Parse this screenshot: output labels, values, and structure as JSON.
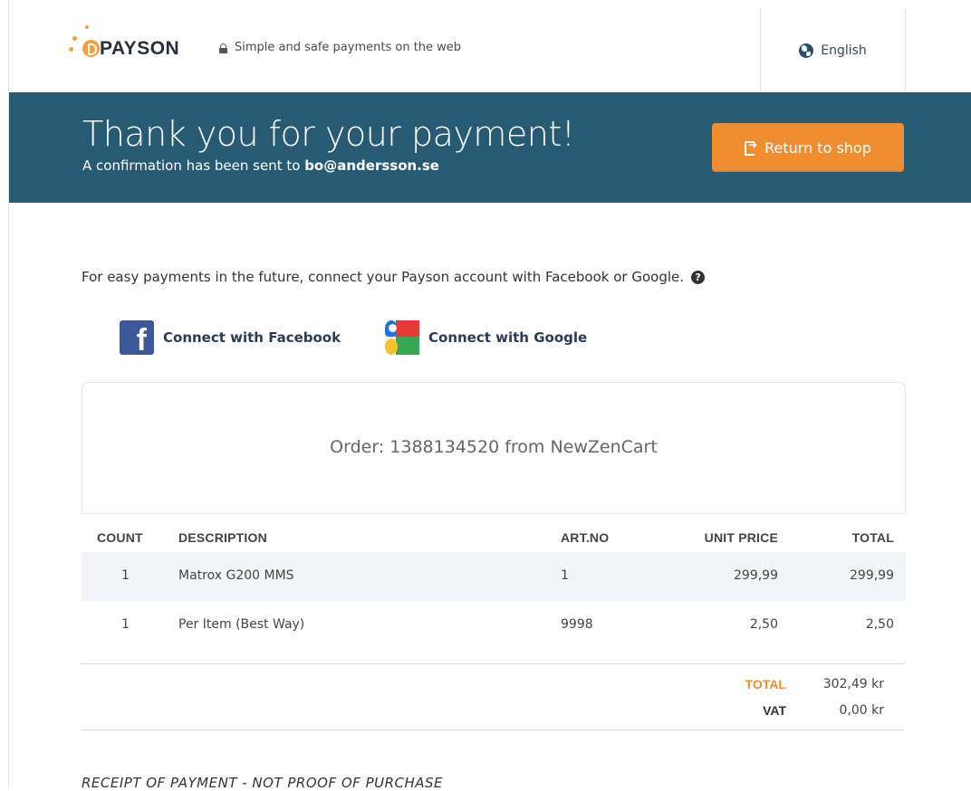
{
  "header": {
    "logo_text": "PAYSON",
    "tagline": "Simple and safe payments on the web",
    "language": "English"
  },
  "banner": {
    "title": "Thank you for your payment!",
    "subtitle_prefix": "A confirmation has been sent to ",
    "email": "bo@andersson.se",
    "return_button": "Return to shop"
  },
  "connect": {
    "text": "For easy payments in the future, connect your Payson account with Facebook or Google.",
    "facebook_label": "Connect with Facebook",
    "google_label": "Connect with Google"
  },
  "order": {
    "title": "Order: 1388134520 from NewZenCart"
  },
  "table": {
    "headers": [
      "COUNT",
      "DESCRIPTION",
      "ART.NO",
      "UNIT PRICE",
      "TOTAL"
    ],
    "rows": [
      {
        "count": "1",
        "description": "Matrox G200 MMS",
        "artno": "1",
        "unit_price": "299,99",
        "total": "299,99"
      },
      {
        "count": "1",
        "description": "Per Item (Best Way)",
        "artno": "9998",
        "unit_price": "2,50",
        "total": "2,50"
      }
    ]
  },
  "summary": {
    "total_label": "TOTAL",
    "total_value": "302,49 kr",
    "vat_label": "VAT",
    "vat_value": "0,00 kr"
  },
  "footer": {
    "receipt_note": "RECEIPT OF PAYMENT - NOT PROOF OF PURCHASE"
  },
  "colors": {
    "banner": "#275a73",
    "accent": "#f08d30",
    "facebook": "#3b5998"
  }
}
